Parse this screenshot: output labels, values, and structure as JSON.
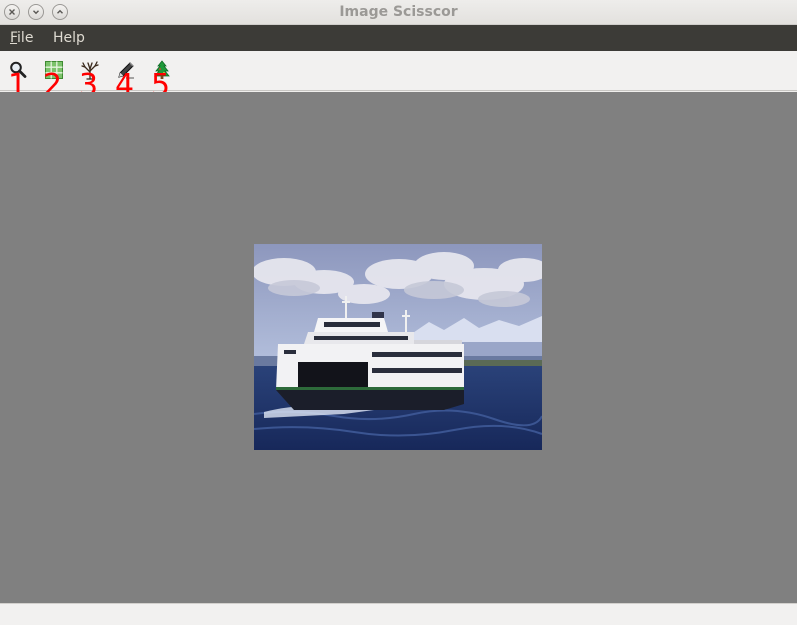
{
  "window": {
    "title": "Image Scisscor",
    "controls": [
      "close-icon",
      "minimize-icon",
      "maximize-icon"
    ]
  },
  "menubar": {
    "file": "File",
    "file_mnemonic": "F",
    "file_rest": "ile",
    "help": "Help"
  },
  "toolbar": {
    "tools": [
      {
        "icon": "magnifier-icon",
        "number": "1"
      },
      {
        "icon": "grid-icon",
        "number": "2"
      },
      {
        "icon": "bare-tree-icon",
        "number": "3"
      },
      {
        "icon": "pencil-icon",
        "number": "4"
      },
      {
        "icon": "christmas-tree-icon",
        "number": "5"
      }
    ]
  },
  "canvas": {
    "background": "#808080",
    "image": "ferry-boat-photo"
  },
  "colors": {
    "menubar_bg": "#3c3b37",
    "menubar_text": "#dfdbd2",
    "annotation_red": "#ff0000"
  }
}
